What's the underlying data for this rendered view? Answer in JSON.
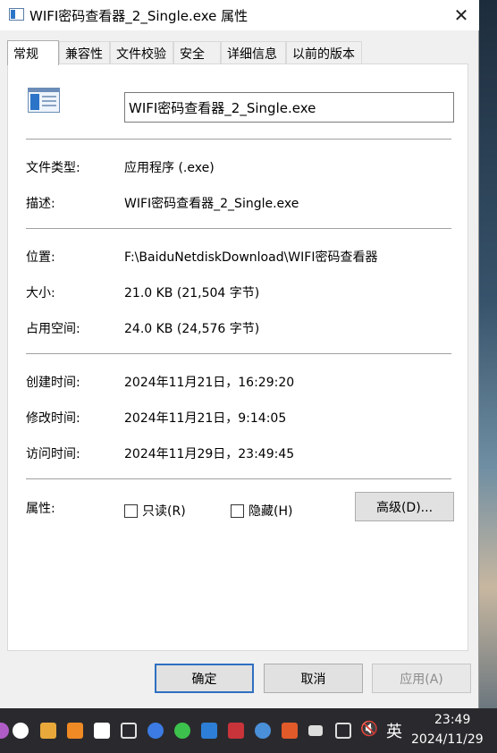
{
  "window": {
    "title": "WIFI密码查看器_2_Single.exe 属性",
    "close_glyph": "✕"
  },
  "tabs": [
    {
      "label": "常规",
      "active": true
    },
    {
      "label": "兼容性",
      "active": false
    },
    {
      "label": "文件校验",
      "active": false
    },
    {
      "label": "安全",
      "active": false
    },
    {
      "label": "详细信息",
      "active": false
    },
    {
      "label": "以前的版本",
      "active": false
    }
  ],
  "general": {
    "file_name": "WIFI密码查看器_2_Single.exe",
    "rows": [
      {
        "label": "文件类型:",
        "value": "应用程序 (.exe)"
      },
      {
        "label": "描述:",
        "value": "WIFI密码查看器_2_Single.exe"
      },
      {
        "label": "位置:",
        "value": "F:\\BaiduNetdiskDownload\\WIFI密码查看器"
      },
      {
        "label": "大小:",
        "value": "21.0 KB (21,504 字节)"
      },
      {
        "label": "占用空间:",
        "value": "24.0 KB (24,576 字节)"
      },
      {
        "label": "创建时间:",
        "value": "2024年11月21日，16:29:20"
      },
      {
        "label": "修改时间:",
        "value": "2024年11月21日，9:14:05"
      },
      {
        "label": "访问时间:",
        "value": "2024年11月29日，23:49:45"
      }
    ],
    "attributes_label": "属性:",
    "readonly_label": "只读(R)",
    "readonly_checked": false,
    "hidden_label": "隐藏(H)",
    "hidden_checked": false,
    "advanced_label": "高级(D)..."
  },
  "buttons": {
    "ok": "确定",
    "cancel": "取消",
    "apply": "应用(A)"
  },
  "taskbar": {
    "ime": "英",
    "time": "23:49",
    "date": "2024/11/29"
  }
}
